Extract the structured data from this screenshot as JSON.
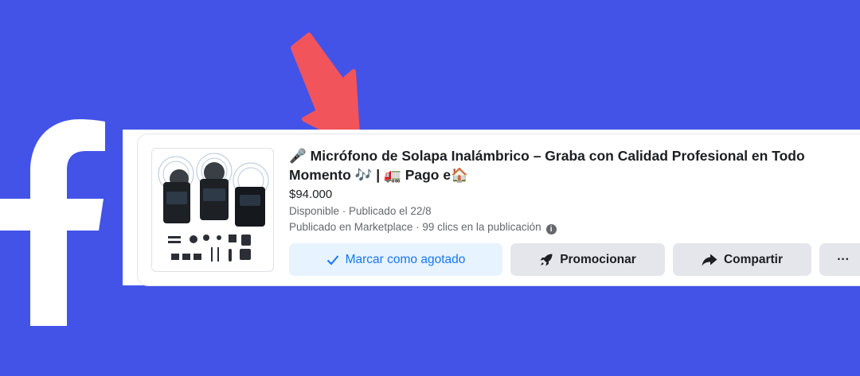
{
  "listing": {
    "title": "🎤 Micrófono de Solapa Inalámbrico – Graba con Calidad Profesional en Todo Momento 🎶 | 🚛 Pago e🏠",
    "price": "$94.000",
    "status_line": "Disponible · Publicado el 22/8",
    "stats_line": "Publicado en Marketplace · 99 clics en la publicación",
    "info_icon": "i",
    "image_desc_icon": "wireless-lavalier-mic-kit"
  },
  "actions": {
    "mark_sold": "Marcar como agotado",
    "promote": "Promocionar",
    "share": "Compartir",
    "more": "···"
  },
  "colors": {
    "background": "#4353e8",
    "arrow": "#f2545b",
    "primary_text": "#1877f2",
    "primary_bg": "#e7f3ff",
    "gray_bg": "#e4e6eb"
  }
}
